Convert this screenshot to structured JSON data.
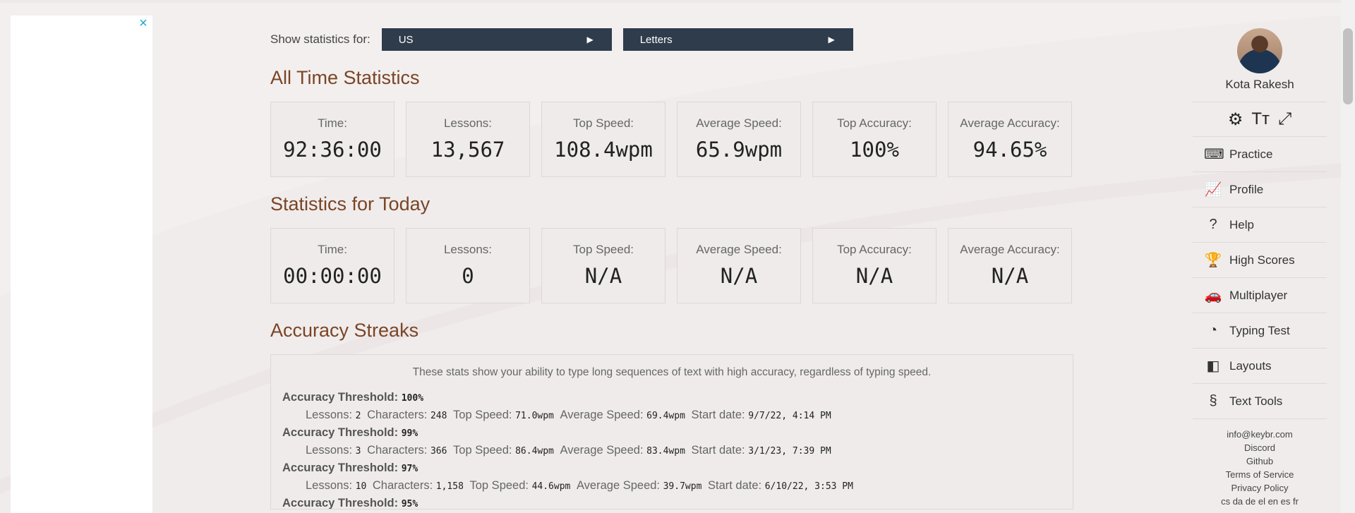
{
  "filter": {
    "label": "Show statistics for:",
    "layout_select": "US",
    "mode_select": "Letters",
    "arrow": "▶"
  },
  "all_time": {
    "title": "All Time Statistics",
    "stats": [
      {
        "label": "Time:",
        "value": "92:36:00"
      },
      {
        "label": "Lessons:",
        "value": "13,567"
      },
      {
        "label": "Top Speed:",
        "value": "108.4wpm"
      },
      {
        "label": "Average Speed:",
        "value": "65.9wpm"
      },
      {
        "label": "Top Accuracy:",
        "value": "100%"
      },
      {
        "label": "Average Accuracy:",
        "value": "94.65%"
      }
    ]
  },
  "today": {
    "title": "Statistics for Today",
    "stats": [
      {
        "label": "Time:",
        "value": "00:00:00"
      },
      {
        "label": "Lessons:",
        "value": "0"
      },
      {
        "label": "Top Speed:",
        "value": "N/A"
      },
      {
        "label": "Average Speed:",
        "value": "N/A"
      },
      {
        "label": "Top Accuracy:",
        "value": "N/A"
      },
      {
        "label": "Average Accuracy:",
        "value": "N/A"
      }
    ]
  },
  "streaks": {
    "title": "Accuracy Streaks",
    "intro": "These stats show your ability to type long sequences of text with high accuracy, regardless of typing speed.",
    "labels": {
      "threshold": "Accuracy Threshold:",
      "lessons": "Lessons:",
      "characters": "Characters:",
      "top_speed": "Top Speed:",
      "avg_speed": "Average Speed:",
      "start_date": "Start date:"
    },
    "items": [
      {
        "threshold": "100%",
        "lessons": "2",
        "characters": "248",
        "top_speed": "71.0wpm",
        "avg_speed": "69.4wpm",
        "start_date": "9/7/22, 4:14 PM"
      },
      {
        "threshold": "99%",
        "lessons": "3",
        "characters": "366",
        "top_speed": "86.4wpm",
        "avg_speed": "83.4wpm",
        "start_date": "3/1/23, 7:39 PM"
      },
      {
        "threshold": "97%",
        "lessons": "10",
        "characters": "1,158",
        "top_speed": "44.6wpm",
        "avg_speed": "39.7wpm",
        "start_date": "6/10/22, 3:53 PM"
      },
      {
        "threshold": "95%"
      }
    ]
  },
  "sidebar": {
    "user_name": "Kota Rakesh",
    "tools": [
      {
        "icon": "settings-icon",
        "glyph": "⚙"
      },
      {
        "icon": "font-size-icon",
        "glyph": "Tт"
      },
      {
        "icon": "fullscreen-icon",
        "glyph": "⤢"
      }
    ],
    "nav": [
      {
        "label": "Practice",
        "icon": "keyboard-icon",
        "glyph": "⌨"
      },
      {
        "label": "Profile",
        "icon": "chart-icon",
        "glyph": "📈"
      },
      {
        "label": "Help",
        "icon": "help-icon",
        "glyph": "?"
      },
      {
        "label": "High Scores",
        "icon": "trophy-icon",
        "glyph": "🏆"
      },
      {
        "label": "Multiplayer",
        "icon": "car-icon",
        "glyph": "🚗"
      },
      {
        "label": "Typing Test",
        "icon": "gauge-icon",
        "glyph": "◔"
      },
      {
        "label": "Layouts",
        "icon": "layouts-icon",
        "glyph": "◧"
      },
      {
        "label": "Text Tools",
        "icon": "section-icon",
        "glyph": "§"
      }
    ],
    "footer": {
      "email": "info@keybr.com",
      "discord": "Discord",
      "github": "Github",
      "terms": "Terms of Service",
      "privacy": "Privacy Policy",
      "languages": "cs da de el en es fr"
    }
  },
  "ad": {
    "close": "×"
  }
}
